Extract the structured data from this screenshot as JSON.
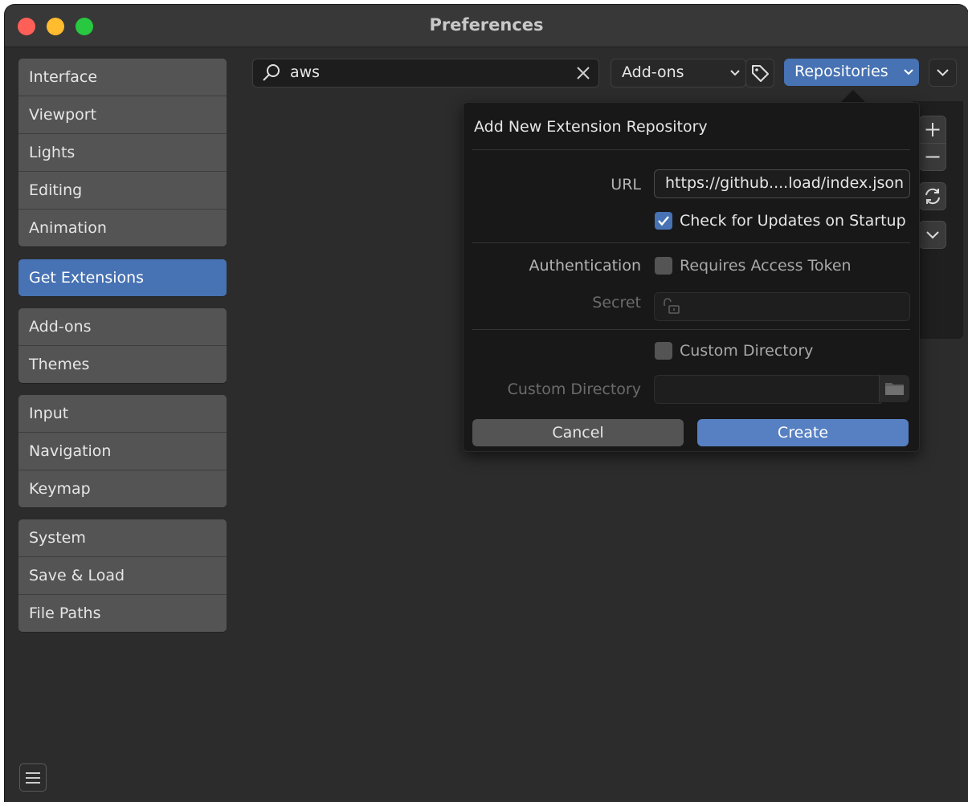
{
  "window": {
    "title": "Preferences"
  },
  "sidebar": {
    "groups": [
      {
        "items": [
          {
            "label": "Interface"
          },
          {
            "label": "Viewport"
          },
          {
            "label": "Lights"
          },
          {
            "label": "Editing"
          },
          {
            "label": "Animation"
          }
        ]
      },
      {
        "items": [
          {
            "label": "Get Extensions",
            "active": true
          }
        ]
      },
      {
        "items": [
          {
            "label": "Add-ons"
          },
          {
            "label": "Themes"
          }
        ]
      },
      {
        "items": [
          {
            "label": "Input"
          },
          {
            "label": "Navigation"
          },
          {
            "label": "Keymap"
          }
        ]
      },
      {
        "items": [
          {
            "label": "System"
          },
          {
            "label": "Save & Load"
          },
          {
            "label": "File Paths"
          }
        ]
      }
    ]
  },
  "toolbar": {
    "search": {
      "value": "aws"
    },
    "filter_dropdown": {
      "selected": "Add-ons"
    },
    "repositories_dropdown": {
      "selected": "Repositories"
    }
  },
  "popup": {
    "title": "Add New Extension Repository",
    "url": {
      "label": "URL",
      "value": "https://github....load/index.json"
    },
    "check_updates": {
      "label": "Check for Updates on Startup",
      "checked": true
    },
    "authentication": {
      "label": "Authentication",
      "checkbox_label": "Requires Access Token",
      "checked": false
    },
    "secret": {
      "label": "Secret",
      "value": ""
    },
    "custom_directory_toggle": {
      "label": "Custom Directory",
      "checked": false
    },
    "custom_directory": {
      "label": "Custom Directory",
      "value": ""
    },
    "cancel": {
      "label": "Cancel"
    },
    "create": {
      "label": "Create"
    }
  },
  "colors": {
    "accent": "#4772b3",
    "background": "#2c2c2c",
    "button": "#545454",
    "create": "#5680c2"
  }
}
